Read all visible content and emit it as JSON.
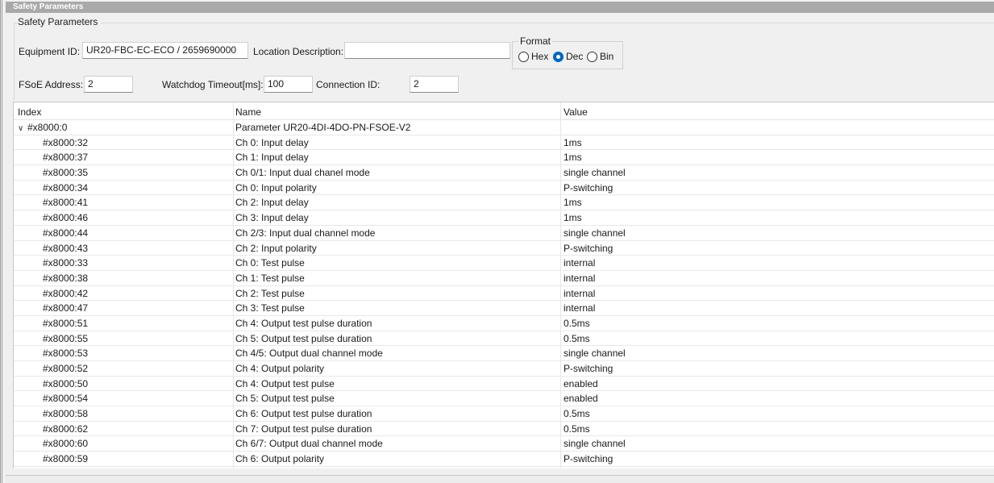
{
  "title_bar": "Safety Parameters",
  "group_title": "Safety Parameters",
  "equipment": {
    "id_label": "Equipment ID:",
    "id_value": "UR20-FBC-EC-ECO / 2659690000",
    "location_label": "Location Description:",
    "location_value": ""
  },
  "format": {
    "label": "Format",
    "options": [
      "Hex",
      "Dec",
      "Bin"
    ],
    "selected": "Dec"
  },
  "fsoe": {
    "address_label": "FSoE Address:",
    "address_value": "2",
    "watchdog_label": "Watchdog Timeout[ms]:",
    "watchdog_value": "100",
    "connection_label": "Connection ID:",
    "connection_value": "2"
  },
  "table": {
    "headers": [
      "Index",
      "Name",
      "Value"
    ],
    "parent": {
      "index": "#x8000:0",
      "name": "Parameter UR20-4DI-4DO-PN-FSOE-V2",
      "value": "",
      "expanded": true
    },
    "rows": [
      {
        "index": "#x8000:32",
        "name": "Ch 0: Input delay",
        "value": "1ms"
      },
      {
        "index": "#x8000:37",
        "name": "Ch 1: Input delay",
        "value": "1ms"
      },
      {
        "index": "#x8000:35",
        "name": "Ch 0/1: Input dual chanel mode",
        "value": "single channel"
      },
      {
        "index": "#x8000:34",
        "name": "Ch 0: Input polarity",
        "value": "P-switching"
      },
      {
        "index": "#x8000:41",
        "name": "Ch 2: Input delay",
        "value": "1ms"
      },
      {
        "index": "#x8000:46",
        "name": "Ch 3: Input delay",
        "value": "1ms"
      },
      {
        "index": "#x8000:44",
        "name": "Ch 2/3: Input dual channel mode",
        "value": "single channel"
      },
      {
        "index": "#x8000:43",
        "name": "Ch 2: Input polarity",
        "value": "P-switching"
      },
      {
        "index": "#x8000:33",
        "name": "Ch 0: Test pulse",
        "value": "internal"
      },
      {
        "index": "#x8000:38",
        "name": "Ch 1: Test pulse",
        "value": "internal"
      },
      {
        "index": "#x8000:42",
        "name": "Ch 2: Test pulse",
        "value": "internal"
      },
      {
        "index": "#x8000:47",
        "name": "Ch 3: Test pulse",
        "value": "internal"
      },
      {
        "index": "#x8000:51",
        "name": "Ch 4: Output test pulse duration",
        "value": "0.5ms"
      },
      {
        "index": "#x8000:55",
        "name": "Ch 5: Output test pulse duration",
        "value": "0.5ms"
      },
      {
        "index": "#x8000:53",
        "name": "Ch 4/5: Output dual channel mode",
        "value": "single channel"
      },
      {
        "index": "#x8000:52",
        "name": "Ch 4: Output polarity",
        "value": "P-switching"
      },
      {
        "index": "#x8000:50",
        "name": "Ch 4: Output test pulse",
        "value": "enabled"
      },
      {
        "index": "#x8000:54",
        "name": "Ch 5: Output test pulse",
        "value": "enabled"
      },
      {
        "index": "#x8000:58",
        "name": "Ch 6: Output test pulse duration",
        "value": "0.5ms"
      },
      {
        "index": "#x8000:62",
        "name": "Ch 7: Output test pulse duration",
        "value": "0.5ms"
      },
      {
        "index": "#x8000:60",
        "name": "Ch 6/7: Output dual channel mode",
        "value": "single channel"
      },
      {
        "index": "#x8000:59",
        "name": "Ch 6: Output polarity",
        "value": "P-switching"
      }
    ]
  }
}
